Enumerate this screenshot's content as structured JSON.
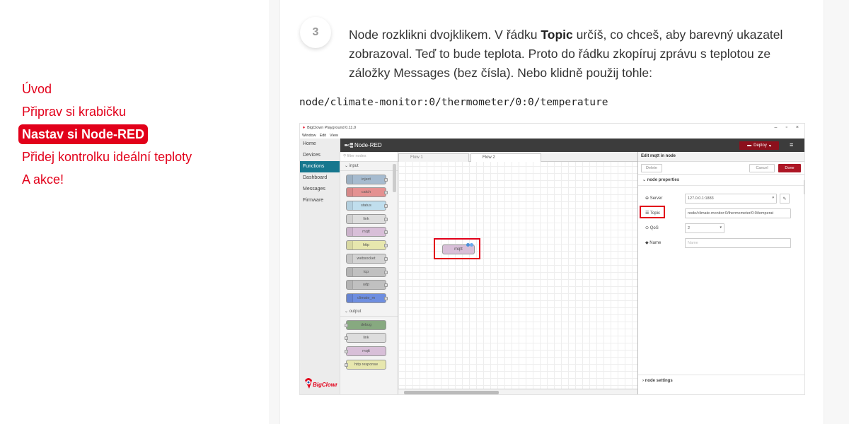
{
  "toc": {
    "items": [
      {
        "label": "Úvod"
      },
      {
        "label": "Připrav si krabičku"
      },
      {
        "label": "Nastav si Node-RED"
      },
      {
        "label": "Přidej kontrolku ideální teploty"
      },
      {
        "label": "A akce!"
      }
    ],
    "active_index": 2
  },
  "step": {
    "number": "3",
    "text_before": "Node rozklikni dvojklikem. V řádku ",
    "bold": "Topic",
    "text_after": " určíš, co chceš, aby barevný ukazatel zobrazoval. Teď to bude teplota. Proto do řádku zkopíruj zprávu s teplotou ze záložky Messages (bez čísla). Nebo klidně použij tohle:",
    "code": "node/climate-monitor:0/thermometer/0:0/temperature"
  },
  "screenshot": {
    "window_title": "BigClown Playground 0.11.0",
    "win_controls": [
      "–",
      "▫",
      "×"
    ],
    "menu": [
      "Window",
      "Edit",
      "View"
    ],
    "app_nav": [
      "Home",
      "Devices",
      "Functions",
      "Dashboard",
      "Messages",
      "Firmware"
    ],
    "app_nav_active": 2,
    "logo_text": "BigClown",
    "nodered_title": "Node-RED",
    "deploy_label": "Deploy",
    "filter_placeholder": "filter nodes",
    "palette_input_label": "input",
    "palette_input_nodes": [
      "inject",
      "catch",
      "status",
      "link",
      "mqtt",
      "http",
      "websocket",
      "tcp",
      "udp",
      "climate_m"
    ],
    "palette_output_label": "output",
    "palette_output_nodes": [
      "debug",
      "link",
      "mqtt",
      "http response"
    ],
    "tabs": [
      "Flow 1",
      "Flow 2"
    ],
    "canvas_node_label": "mqtt",
    "editor": {
      "title": "Edit mqtt in node",
      "delete_label": "Delete",
      "cancel_label": "Cancel",
      "done_label": "Done",
      "section_label": "node properties",
      "server_label": "Server",
      "server_value": "127.0.0.1:1883",
      "topic_label": "Topic",
      "topic_value": "node/climate-monitor:0/thermometer/0:0/temperat",
      "qos_label": "QoS",
      "qos_value": "2",
      "name_label": "Name",
      "name_placeholder": "Name",
      "footer_label": "node settings"
    }
  },
  "colors": {
    "accent_red": "#e2001a",
    "teal_active": "#17778e",
    "deploy_red": "#8c101c",
    "done_red": "#ad1625"
  }
}
